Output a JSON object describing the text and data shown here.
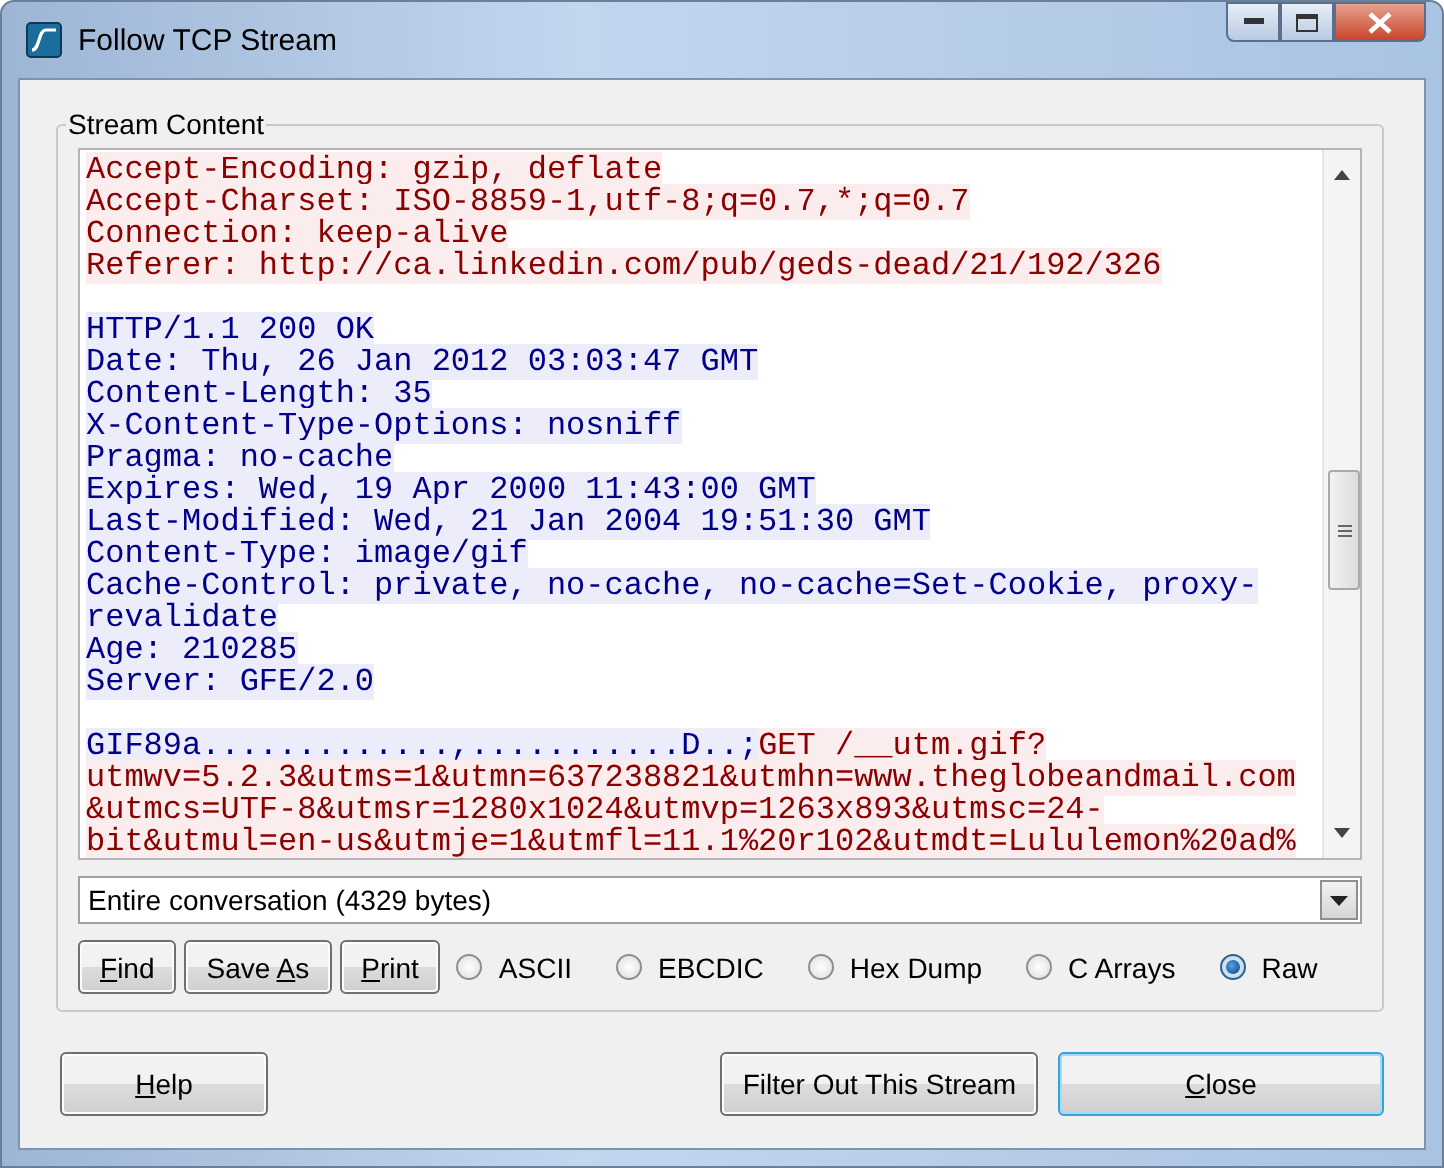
{
  "window": {
    "title": "Follow TCP Stream"
  },
  "stream": {
    "label": "Stream Content",
    "lines": [
      {
        "kind": "text",
        "segments": [
          {
            "kind": "client",
            "text": "Accept-Encoding: gzip, deflate"
          }
        ]
      },
      {
        "kind": "text",
        "segments": [
          {
            "kind": "client",
            "text": "Accept-Charset: ISO-8859-1,utf-8;q=0.7,*;q=0.7"
          }
        ]
      },
      {
        "kind": "text",
        "segments": [
          {
            "kind": "client",
            "text": "Connection: keep-alive"
          }
        ]
      },
      {
        "kind": "text",
        "segments": [
          {
            "kind": "client",
            "text": "Referer: http://ca.linkedin.com/pub/geds-dead/21/192/326"
          }
        ]
      },
      {
        "kind": "blank"
      },
      {
        "kind": "text",
        "segments": [
          {
            "kind": "server",
            "text": "HTTP/1.1 200 OK"
          }
        ]
      },
      {
        "kind": "text",
        "segments": [
          {
            "kind": "server",
            "text": "Date: Thu, 26 Jan 2012 03:03:47 GMT"
          }
        ]
      },
      {
        "kind": "text",
        "segments": [
          {
            "kind": "server",
            "text": "Content-Length: 35"
          }
        ]
      },
      {
        "kind": "text",
        "segments": [
          {
            "kind": "server",
            "text": "X-Content-Type-Options: nosniff"
          }
        ]
      },
      {
        "kind": "text",
        "segments": [
          {
            "kind": "server",
            "text": "Pragma: no-cache"
          }
        ]
      },
      {
        "kind": "text",
        "segments": [
          {
            "kind": "server",
            "text": "Expires: Wed, 19 Apr 2000 11:43:00 GMT"
          }
        ]
      },
      {
        "kind": "text",
        "segments": [
          {
            "kind": "server",
            "text": "Last-Modified: Wed, 21 Jan 2004 19:51:30 GMT"
          }
        ]
      },
      {
        "kind": "text",
        "segments": [
          {
            "kind": "server",
            "text": "Content-Type: image/gif"
          }
        ]
      },
      {
        "kind": "text",
        "segments": [
          {
            "kind": "server",
            "text": "Cache-Control: private, no-cache, no-cache=Set-Cookie, proxy-"
          }
        ]
      },
      {
        "kind": "text",
        "segments": [
          {
            "kind": "server",
            "text": "revalidate"
          }
        ]
      },
      {
        "kind": "text",
        "segments": [
          {
            "kind": "server",
            "text": "Age: 210285"
          }
        ]
      },
      {
        "kind": "text",
        "segments": [
          {
            "kind": "server",
            "text": "Server: GFE/2.0"
          }
        ]
      },
      {
        "kind": "blank"
      },
      {
        "kind": "text",
        "segments": [
          {
            "kind": "server",
            "text": "GIF89a.............,...........D..;"
          },
          {
            "kind": "client",
            "text": "GET /__utm.gif?"
          }
        ]
      },
      {
        "kind": "text",
        "segments": [
          {
            "kind": "client",
            "text": "utmwv=5.2.3&utms=1&utmn=637238821&utmhn=www.theglobeandmail.com"
          }
        ]
      },
      {
        "kind": "text",
        "segments": [
          {
            "kind": "client",
            "text": "&utmcs=UTF-8&utmsr=1280x1024&utmvp=1263x893&utmsc=24-"
          }
        ]
      },
      {
        "kind": "text",
        "segments": [
          {
            "kind": "client",
            "text": "bit&utmul=en-us&utmje=1&utmfl=11.1%20r102&utmdt=Lululemon%20ad%"
          }
        ]
      }
    ],
    "conversation": "Entire conversation (4329 bytes)",
    "actions": [
      {
        "label": "Find"
      },
      {
        "label": "Save As"
      },
      {
        "label": "Print"
      }
    ],
    "formats": [
      {
        "label": "ASCII",
        "selected": false
      },
      {
        "label": "EBCDIC",
        "selected": false
      },
      {
        "label": "Hex Dump",
        "selected": false
      },
      {
        "label": "C Arrays",
        "selected": false
      },
      {
        "label": "Raw",
        "selected": true
      }
    ]
  },
  "footer": {
    "help": "Help",
    "filter": "Filter Out This Stream",
    "close": "Close"
  }
}
